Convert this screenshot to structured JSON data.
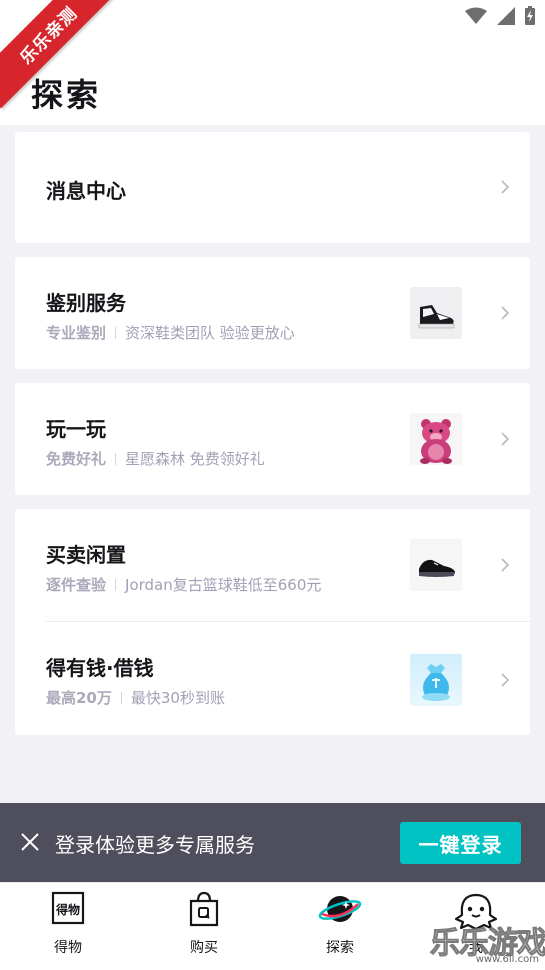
{
  "status_bar": {
    "icons": [
      "wifi-icon",
      "signal-icon",
      "battery-icon"
    ]
  },
  "ribbon": {
    "text": "乐乐亲测"
  },
  "page": {
    "title": "探索"
  },
  "sections": [
    {
      "title": "消息中心"
    },
    {
      "title": "鉴别服务",
      "tag": "专业鉴别",
      "desc": "资深鞋类团队 验验更放心",
      "image": "sneaker-image"
    },
    {
      "title": "玩一玩",
      "tag": "免费好礼",
      "desc": "星愿森林 免费领好礼",
      "image": "plush-bear-image"
    },
    {
      "title": "买卖闲置",
      "tag": "逐件查验",
      "desc": "Jordan复古篮球鞋低至660元",
      "image": "basketball-shoe-image"
    },
    {
      "title": "得有钱·借钱",
      "tag": "最高20万",
      "desc": "最快30秒到账",
      "image": "money-bag-image"
    }
  ],
  "login_banner": {
    "text": "登录体验更多专属服务",
    "button": "一键登录"
  },
  "tabbar": {
    "items": [
      {
        "label": "得物",
        "icon": "dewu-logo-icon"
      },
      {
        "label": "购买",
        "icon": "shopping-bag-icon"
      },
      {
        "label": "探索",
        "icon": "planet-icon",
        "active": true
      },
      {
        "label": "我",
        "icon": "ghost-avatar-icon"
      }
    ]
  },
  "watermark": {
    "title": "乐乐游戏",
    "url": "www.6ll.com"
  },
  "colors": {
    "accent": "#01c2c3",
    "banner_bg": "#4e4e5c",
    "ribbon": "#d7262b",
    "page_bg": "#f1f1f6",
    "subtitle": "#a1a1b6"
  }
}
